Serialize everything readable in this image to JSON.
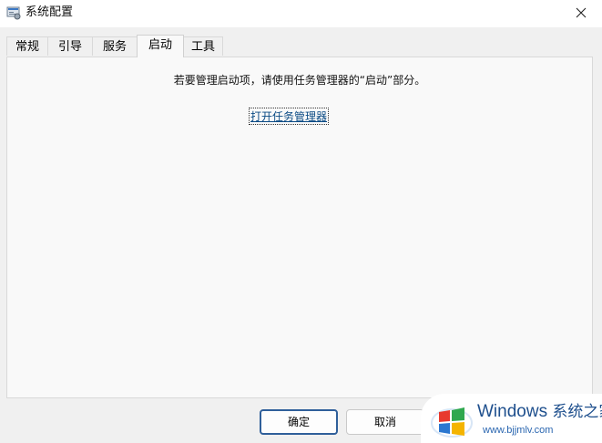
{
  "window": {
    "title": "系统配置"
  },
  "tabs": [
    {
      "label": "常规"
    },
    {
      "label": "引导"
    },
    {
      "label": "服务"
    },
    {
      "label": "启动",
      "active": true
    },
    {
      "label": "工具"
    }
  ],
  "startup_panel": {
    "message": "若要管理启动项，请使用任务管理器的“启动”部分。",
    "link_label": "打开任务管理器"
  },
  "buttons": {
    "ok_label": "确定",
    "cancel_label": "取消"
  },
  "watermark": {
    "brand": "Windows",
    "brand_suffix": "系统之家",
    "url": "www.bjjmlv.com"
  },
  "colors": {
    "link": "#0a4a84",
    "primary_button_border": "#2f5f9a",
    "watermark_text": "#1e4f8d"
  },
  "icons": {
    "app": "msconfig-icon",
    "close": "close-icon",
    "watermark_logo": "windows-logo-icon"
  }
}
